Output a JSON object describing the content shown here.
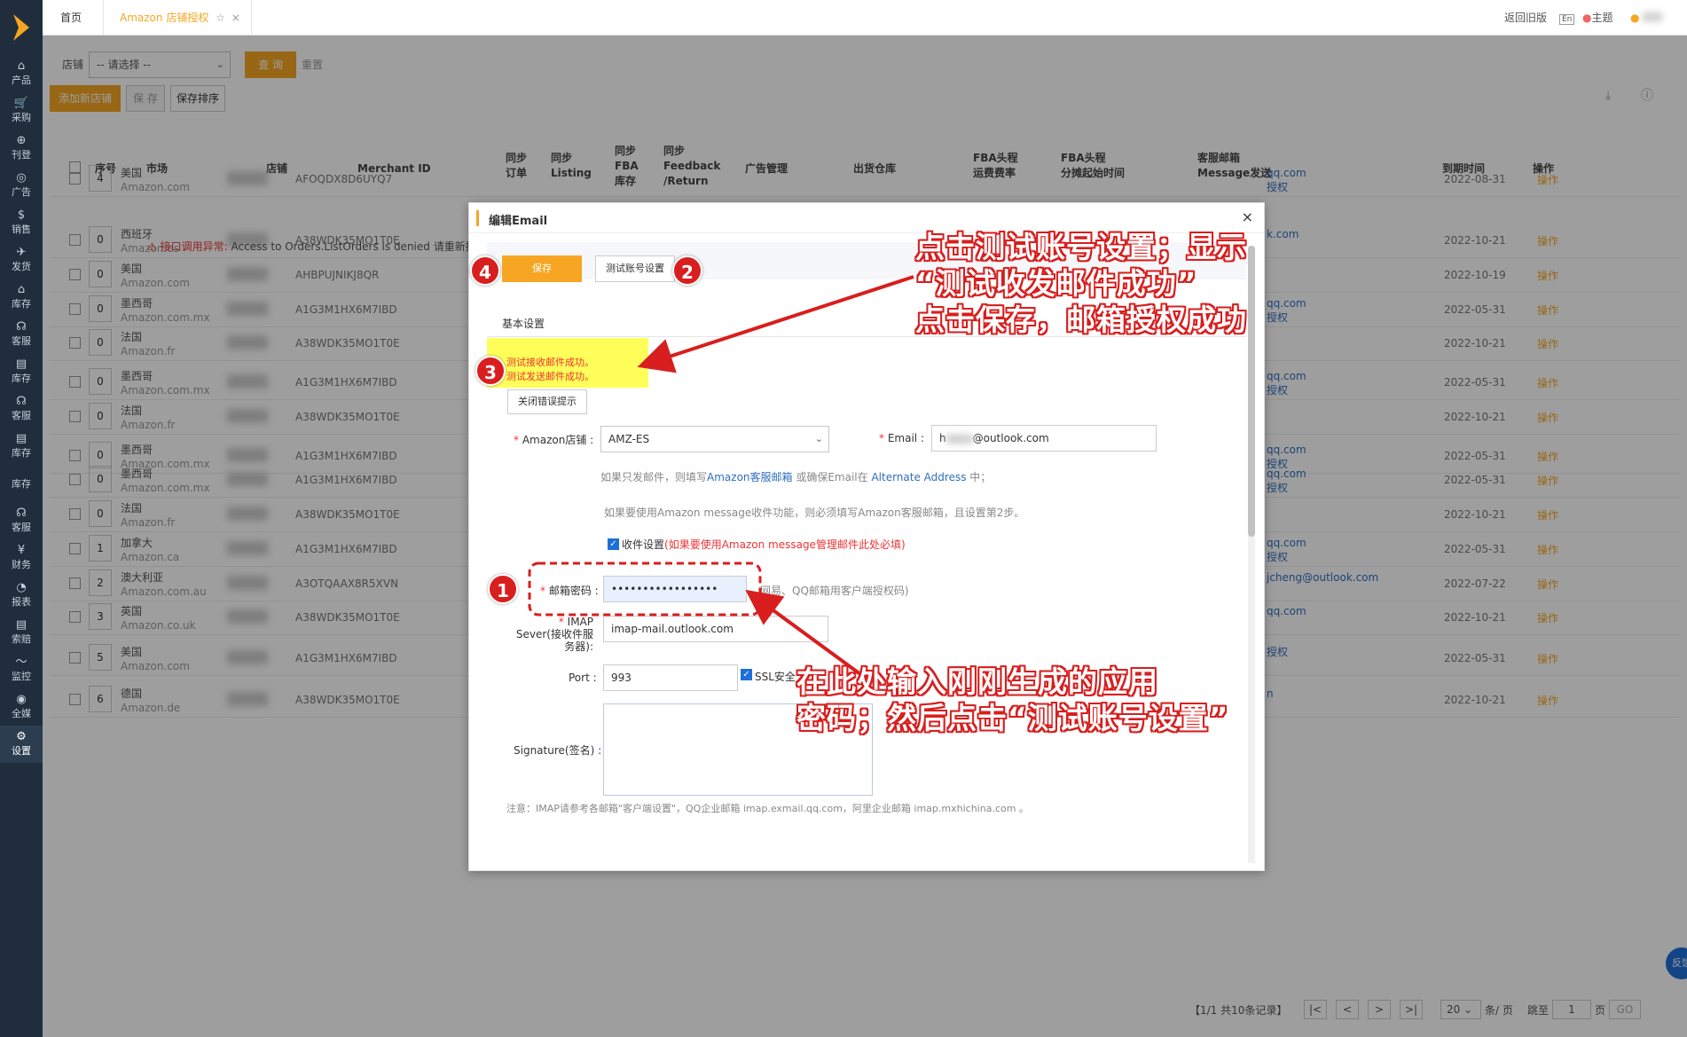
{
  "sidebar": {
    "items": [
      {
        "icon": "⌂",
        "label": "产品"
      },
      {
        "icon": "🛒",
        "label": "采购"
      },
      {
        "icon": "⊕",
        "label": "刊登"
      },
      {
        "icon": "◎",
        "label": "广告"
      },
      {
        "icon": "$",
        "label": "销售"
      },
      {
        "icon": "✈",
        "label": "发货"
      },
      {
        "icon": "⌂",
        "label": "库存"
      },
      {
        "icon": "☊",
        "label": "客服"
      },
      {
        "icon": "▤",
        "label": "库存"
      },
      {
        "icon": "☊",
        "label": "客服"
      },
      {
        "icon": "▤",
        "label": "库存"
      },
      {
        "icon": "",
        "label": "库存"
      },
      {
        "icon": "☊",
        "label": "客服"
      },
      {
        "icon": "¥",
        "label": "财务"
      },
      {
        "icon": "◔",
        "label": "报表"
      },
      {
        "icon": "▤",
        "label": "索赔"
      },
      {
        "icon": "〜",
        "label": "监控"
      },
      {
        "icon": "◉",
        "label": "全媒"
      },
      {
        "icon": "⚙",
        "label": "设置"
      }
    ]
  },
  "topbar": {
    "home": "首页",
    "active_tab": "Amazon 店铺授权",
    "back_old": "返回旧版",
    "theme": "主题",
    "lang": "En"
  },
  "filter": {
    "shop_label": "店铺",
    "shop_select": "-- 请选择 --",
    "query": "查 询",
    "reset": "重置"
  },
  "toolbar": {
    "add_shop": "添加新店铺",
    "save": "保 存",
    "save_sort": "保存排序"
  },
  "table": {
    "headers": {
      "seq": "序号",
      "market": "市场",
      "shop": "店铺",
      "merchant": "Merchant ID",
      "sync_order": "同步\n订单",
      "sync_listing": "同步\nListing",
      "sync_fba": "同步\nFBA\n库存",
      "sync_feedback": "同步\nFeedback\n/Return",
      "ads": "广告管理",
      "warehouse": "出货仓库",
      "fba_rate": "FBA头程\n运费费率",
      "fba_date": "FBA头程\n分摊起始时间",
      "cs_email": "客服邮箱\nMessage发送",
      "expire": "到期时间",
      "ops": "操作"
    },
    "rows": [
      {
        "seq": "4",
        "market": "美国",
        "site": "Amazon.com",
        "merchant": "AFOQDX8D6UYQ7",
        "email": "qq.com",
        "email2": "授权",
        "expire": "2022-08-31",
        "op": "操作"
      },
      {
        "seq": "0",
        "market": "西班牙",
        "site": "Amazon.es",
        "merchant": "A38WDK35MO1T0E",
        "email": "k.com",
        "email2": "",
        "expire": "2022-10-21",
        "op": "操作"
      },
      {
        "seq": "0",
        "market": "美国",
        "site": "Amazon.com",
        "merchant": "AHBPUJNIKJ8QR",
        "email": "",
        "email2": "",
        "expire": "2022-10-19",
        "op": "操作"
      },
      {
        "seq": "0",
        "market": "墨西哥",
        "site": "Amazon.com.mx",
        "merchant": "A1G3M1HX6M7IBD",
        "email": "qq.com",
        "email2": "授权",
        "expire": "2022-05-31",
        "op": "操作"
      },
      {
        "seq": "0",
        "market": "法国",
        "site": "Amazon.fr",
        "merchant": "A38WDK35MO1T0E",
        "email": "",
        "email2": "",
        "expire": "2022-10-21",
        "op": "操作"
      },
      {
        "seq": "0",
        "market": "墨西哥",
        "site": "Amazon.com.mx",
        "merchant": "A1G3M1HX6M7IBD",
        "email": "qq.com",
        "email2": "授权",
        "expire": "2022-05-31",
        "op": "操作"
      },
      {
        "seq": "0",
        "market": "法国",
        "site": "Amazon.fr",
        "merchant": "A38WDK35MO1T0E",
        "email": "",
        "email2": "",
        "expire": "2022-10-21",
        "op": "操作"
      },
      {
        "seq": "0",
        "market": "墨西哥",
        "site": "Amazon.com.mx",
        "merchant": "A1G3M1HX6M7IBD",
        "email": "qq.com",
        "email2": "授权",
        "expire": "2022-05-31",
        "op": "操作"
      },
      {
        "seq": "0",
        "market": "墨西哥",
        "site": "Amazon.com.mx",
        "merchant": "A1G3M1HX6M7IBD",
        "email": "qq.com",
        "email2": "授权",
        "expire": "2022-05-31",
        "op": "操作"
      },
      {
        "seq": "0",
        "market": "法国",
        "site": "Amazon.fr",
        "merchant": "A38WDK35MO1T0E",
        "email": "",
        "email2": "",
        "expire": "2022-10-21",
        "op": "操作"
      },
      {
        "seq": "1",
        "market": "加拿大",
        "site": "Amazon.ca",
        "merchant": "A1G3M1HX6M7IBD",
        "email": "qq.com",
        "email2": "授权",
        "expire": "2022-05-31",
        "op": "操作"
      },
      {
        "seq": "2",
        "market": "澳大利亚",
        "site": "Amazon.com.au",
        "merchant": "A3OTQAAX8R5XVN",
        "email": "jcheng@outlook.com",
        "email2": "",
        "expire": "2022-07-22",
        "op": "操作"
      },
      {
        "seq": "3",
        "market": "英国",
        "site": "Amazon.co.uk",
        "merchant": "A38WDK35MO1T0E",
        "email": "qq.com",
        "email2": "",
        "expire": "2022-10-21",
        "op": "操作"
      },
      {
        "seq": "5",
        "market": "美国",
        "site": "Amazon.com",
        "merchant": "A1G3M1HX6M7IBD",
        "email": "",
        "email2": "授权",
        "expire": "2022-05-31",
        "op": "操作"
      },
      {
        "seq": "6",
        "market": "德国",
        "site": "Amazon.de",
        "merchant": "A38WDK35MO1T0E",
        "email": "",
        "email2": "n",
        "expire": "2022-10-21",
        "op": "操作"
      }
    ],
    "error_label": "接口调用异常:",
    "error_text": "Access to Orders.ListOrders is denied 请重新授"
  },
  "pagination": {
    "info": "【1/1  共10条记录】",
    "size": "20",
    "per_page": "条/ 页",
    "jump": "跳至",
    "page": "1",
    "page_unit": "页",
    "go": "GO"
  },
  "modal": {
    "title": "编辑Email",
    "save": "保存",
    "test": "测试账号设置",
    "section": "基本设置",
    "success1": "测试接收邮件成功。",
    "success2": "测试发送邮件成功。",
    "close_err": "关闭错误提示",
    "shop_label": "Amazon店铺",
    "shop_value": "AMZ-ES",
    "email_label": "Email",
    "email_prefix": "h",
    "email_value": "@outlook.com",
    "hint1_a": "如果只发邮件，则填写",
    "hint1_b": "Amazon客服邮箱",
    "hint1_c": " 或确保Email在 ",
    "hint1_d": "Alternate Address",
    "hint1_e": " 中；",
    "hint2": "如果要使用Amazon message收件功能，则必须填写Amazon客服邮箱，且设置第2步。",
    "recv_label": "收件设置",
    "recv_note": "(如果要使用Amazon message管理邮件此处必填)",
    "pwd_label": "邮箱密码",
    "pwd_value": "•••••••••••••••••",
    "pwd_note": "网易、QQ邮箱用客户端授权码)",
    "imap_label1": "IMAP",
    "imap_label2": "Sever(接收件服",
    "imap_label3": "务器)",
    "imap_value": "imap-mail.outlook.com",
    "port_label": "Port",
    "port_value": "993",
    "ssl_label": "SSL安全",
    "sig_label": "Signature(签名)",
    "footnote": "注意：IMAP请参考各邮箱\"客户端设置\"，QQ企业邮箱 imap.exmail.qq.com，阿里企业邮箱 imap.mxhichina.com 。"
  },
  "annotations": {
    "a_top_1": "点击测试账号设置；显示",
    "a_top_2": "“测试收发邮件成功”",
    "a_top_3": "点击保存，邮箱授权成功",
    "a_bot_1": "在此处输入刚刚生成的应用",
    "a_bot_2": "密码；然后点击“测试账号设置”",
    "n1": "1",
    "n2": "2",
    "n3": "3",
    "n4": "4"
  },
  "feedback": "反馈",
  "colors": {
    "accent": "#f6a623",
    "sidebar": "#1f2d3d",
    "annotation_red": "#d81e1e",
    "highlight": "#ffff5a"
  }
}
